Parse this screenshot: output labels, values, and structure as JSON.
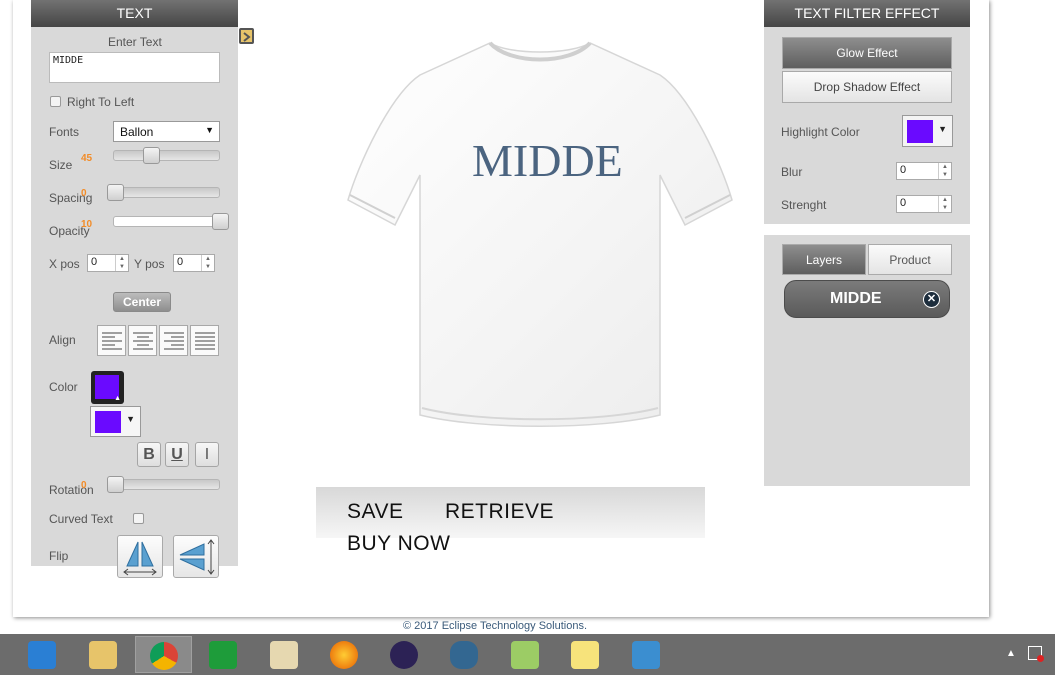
{
  "left_panel": {
    "title": "TEXT",
    "enter_text_label": "Enter Text",
    "text_value": "MIDDE",
    "rtl_label": "Right To Left",
    "fonts_label": "Fonts",
    "font_value": "Ballon",
    "size_label": "Size",
    "size_value": "45",
    "spacing_label": "Spacing",
    "spacing_value": "0",
    "opacity_label": "Opacity",
    "opacity_value": "10",
    "xpos_label": "X pos",
    "xpos_value": "0",
    "ypos_label": "Y pos",
    "ypos_value": "0",
    "center_label": "Center",
    "align_label": "Align",
    "color_label": "Color",
    "bold_label": "B",
    "underline_label": "U",
    "italic_label": "I",
    "rotation_label": "Rotation",
    "rotation_value": "0",
    "curved_label": "Curved Text",
    "flip_label": "Flip"
  },
  "canvas": {
    "design_text": "MIDDE",
    "save_label": "SAVE",
    "retrieve_label": "RETRIEVE",
    "buy_label": "BUY NOW"
  },
  "filter_panel": {
    "title": "TEXT FILTER EFFECT",
    "glow_label": "Glow Effect",
    "shadow_label": "Drop Shadow Effect",
    "highlight_label": "Highlight Color",
    "blur_label": "Blur",
    "blur_value": "0",
    "strength_label": "Strenght",
    "strength_value": "0"
  },
  "layers_panel": {
    "tab_layers": "Layers",
    "tab_product": "Product",
    "layer_name": "MIDDE"
  },
  "footer": {
    "copyright": "© 2017 Eclipse Technology Solutions."
  },
  "colors": {
    "text_color": "#6a0aff",
    "highlight_color": "#6a0aff",
    "design_text_color": "#4b6480"
  },
  "taskbar": {
    "apps": [
      "visual-studio-code",
      "file-explorer",
      "chrome",
      "store",
      "paint",
      "firefox",
      "eclipse",
      "postgresql",
      "notepad-plus-plus",
      "sticky-notes",
      "photos"
    ]
  }
}
